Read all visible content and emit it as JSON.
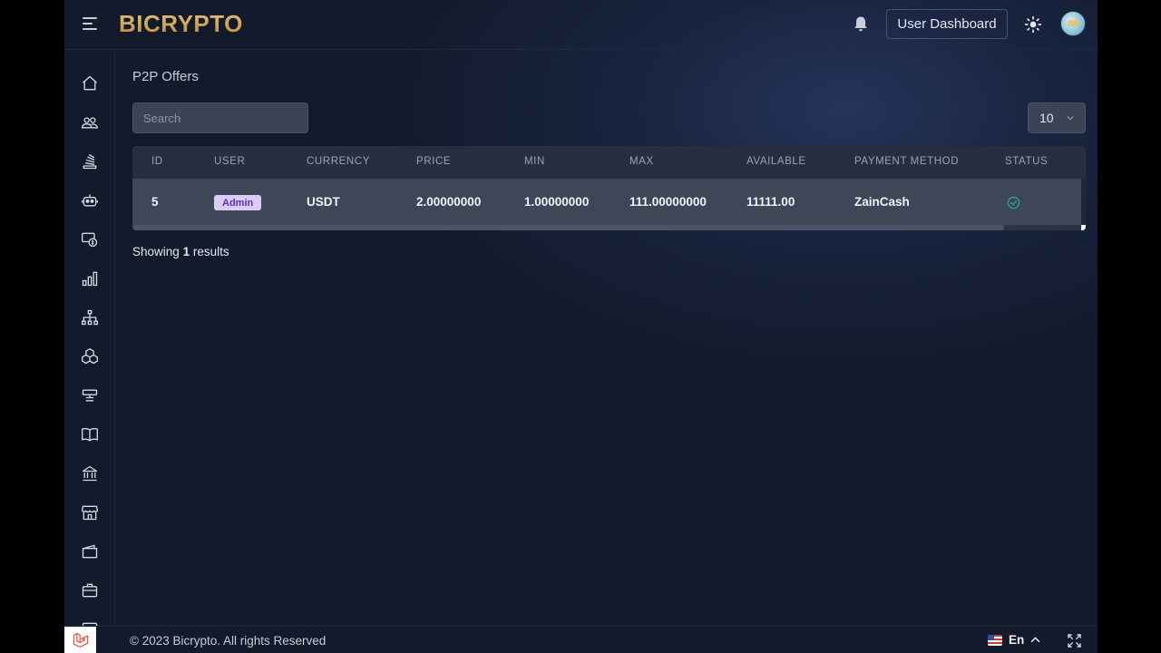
{
  "brand": {
    "logo_text": "BICRYPTO",
    "gold": "#d4a75a"
  },
  "header": {
    "menu_icon": "hamburger-icon",
    "notifications_icon": "bell-icon",
    "dashboard_button_label": "User Dashboard",
    "theme_icon": "sun-icon",
    "avatar_icon": "user-avatar"
  },
  "sidebar": {
    "items": [
      {
        "icon": "home-icon"
      },
      {
        "icon": "users-icon"
      },
      {
        "icon": "stack-icon"
      },
      {
        "icon": "robot-icon"
      },
      {
        "icon": "money-icon"
      },
      {
        "icon": "chart-bars-icon"
      },
      {
        "icon": "sitemap-icon"
      },
      {
        "icon": "cubes-icon"
      },
      {
        "icon": "sliders-icon"
      },
      {
        "icon": "book-icon"
      },
      {
        "icon": "bank-icon"
      },
      {
        "icon": "store-icon"
      },
      {
        "icon": "wallet-icon"
      },
      {
        "icon": "briefcase-icon"
      }
    ]
  },
  "main": {
    "title": "P2P Offers",
    "search_placeholder": "Search",
    "per_page": "10",
    "table": {
      "columns": {
        "id": "ID",
        "user": "USER",
        "currency": "CURRENCY",
        "price": "PRICE",
        "min": "MIN",
        "max": "MAX",
        "available": "AVAILABLE",
        "payment_method": "PAYMENT METHOD",
        "status": "STATUS"
      },
      "rows": [
        {
          "id": "5",
          "user": "Admin",
          "currency": "USDT",
          "price": "2.00000000",
          "min": "1.00000000",
          "max": "111.00000000",
          "available": "11111.00",
          "payment_method": "ZainCash",
          "status_icon": "check-circle-icon"
        }
      ]
    },
    "showing_prefix": "Showing",
    "showing_count": "1",
    "showing_suffix": "results"
  },
  "footer": {
    "copyright": "© 2023 Bicrypto. All rights Reserved",
    "language": "En",
    "fullscreen_icon": "expand-icon",
    "laravel_icon": "laravel-logo-icon"
  },
  "colors": {
    "status_ok": "#2ba58c",
    "badge_bg": "#d9ccf5",
    "badge_text": "#5b2fc0"
  }
}
